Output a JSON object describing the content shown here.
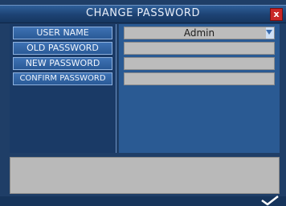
{
  "window": {
    "title": "CHANGE PASSWORD",
    "close_label": "x"
  },
  "labels": [
    {
      "key": "user_name",
      "text": "USER NAME"
    },
    {
      "key": "old_password",
      "text": "OLD PASSWORD"
    },
    {
      "key": "new_password",
      "text": "NEW PASSWORD"
    },
    {
      "key": "confirm_password",
      "text": "CONFIRM PASSWORD"
    }
  ],
  "fields": {
    "user_name": {
      "value": "Admin",
      "type": "select"
    },
    "old_password": {
      "value": ""
    },
    "new_password": {
      "value": ""
    },
    "confirm_password": {
      "value": ""
    }
  },
  "icons": {
    "close": "close-icon",
    "dropdown": "chevron-down-icon",
    "confirm": "checkmark-icon"
  },
  "colors": {
    "panel": "#1f3e67",
    "label_button": "#3e72b4",
    "field_bg": "#bcbcbc",
    "close_red": "#c92626"
  }
}
